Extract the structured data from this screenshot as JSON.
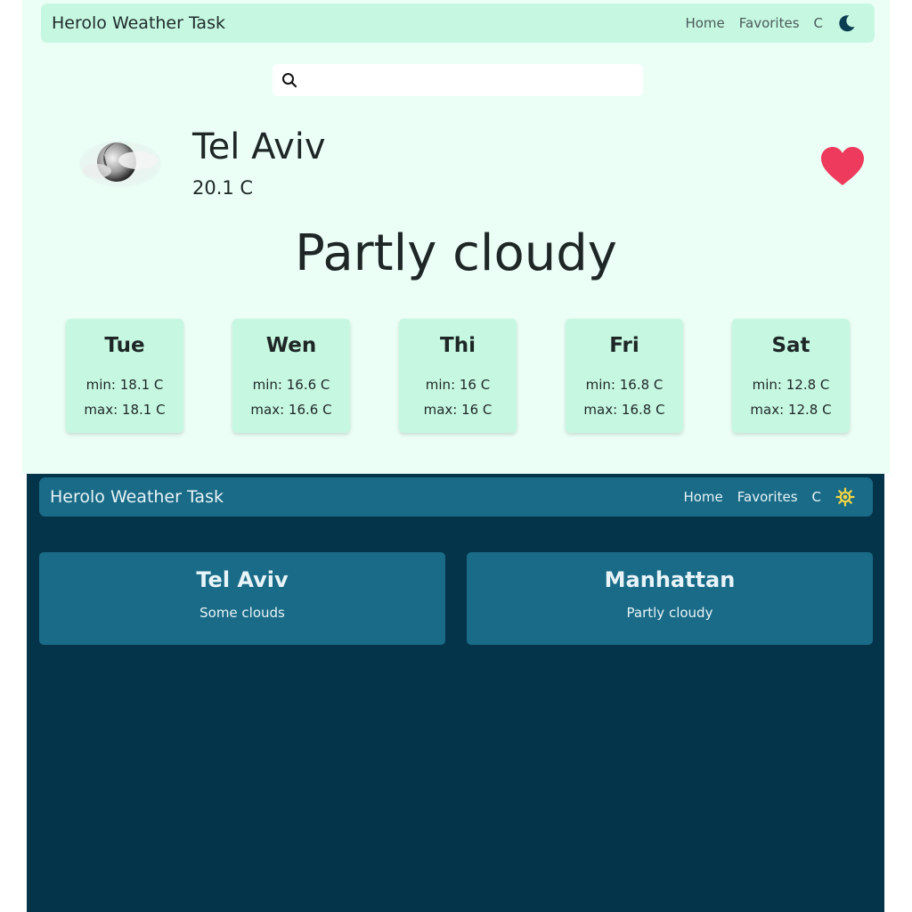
{
  "light": {
    "navbar": {
      "brand": "Herolo Weather Task",
      "links": [
        "Home",
        "Favorites",
        "C"
      ],
      "theme_icon": "moon-icon"
    },
    "search": {
      "icon": "search-icon",
      "value": "",
      "placeholder": ""
    },
    "current": {
      "city": "Tel Aviv",
      "temperature": "20.1 C",
      "condition": "Partly cloudy",
      "weather_icon": "partly-cloudy-night-icon",
      "favorite_icon": "heart-icon"
    },
    "forecast": [
      {
        "day": "Tue",
        "min": "min: 18.1 C",
        "max": "max: 18.1 C"
      },
      {
        "day": "Wen",
        "min": "min: 16.6 C",
        "max": "max: 16.6 C"
      },
      {
        "day": "Thi",
        "min": "min: 16 C",
        "max": "max: 16 C"
      },
      {
        "day": "Fri",
        "min": "min: 16.8 C",
        "max": "max: 16.8 C"
      },
      {
        "day": "Sat",
        "min": "min: 12.8 C",
        "max": "max: 12.8 C"
      }
    ]
  },
  "dark": {
    "navbar": {
      "brand": "Herolo Weather Task",
      "links": [
        "Home",
        "Favorites",
        "C"
      ],
      "theme_icon": "sun-icon"
    },
    "favorites": [
      {
        "city": "Tel Aviv",
        "condition": "Some clouds"
      },
      {
        "city": "Manhattan",
        "condition": "Partly cloudy"
      }
    ]
  },
  "colors": {
    "light_bg": "#ebfff7",
    "light_accent": "#c6f8e1",
    "dark_bg": "#04344a",
    "dark_accent": "#1a6b87",
    "heart": "#ee3a5c",
    "sun": "#f2d544"
  }
}
